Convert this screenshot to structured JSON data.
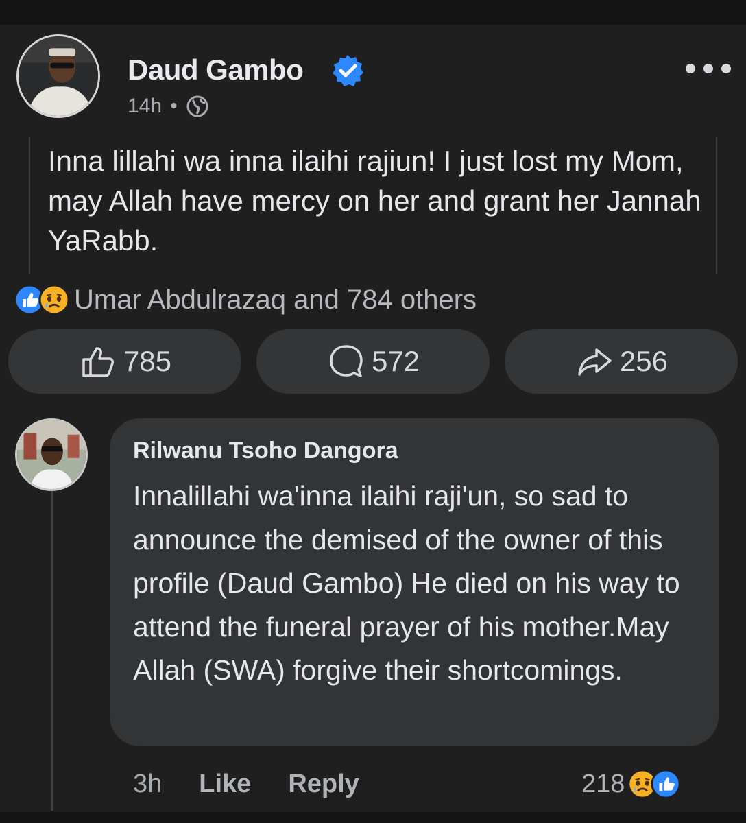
{
  "post": {
    "author": "Daud Gambo",
    "time": "14h",
    "separator": "•",
    "text": "Inna lillahi wa inna ilaihi rajiun! I just lost my Mom, may Allah have mercy on her and grant her Jannah YaRabb.",
    "reaction_summary": "Umar Abdulrazaq and 784 others",
    "reaction_icons": [
      "like-icon",
      "sad-icon"
    ],
    "actions": {
      "like_count": "785",
      "comment_count": "572",
      "share_count": "256"
    }
  },
  "comment": {
    "author": "Rilwanu Tsoho Dangora",
    "text": "Innalillahi wa'inna ilaihi raji'un, so sad to announce the demised of the owner of this profile (Daud Gambo) He died on his way to attend the funeral prayer of his mother.May Allah (SWA) forgive their shortcomings.",
    "time": "3h",
    "like_label": "Like",
    "reply_label": "Reply",
    "reaction_count": "218",
    "reaction_icons": [
      "sad-icon",
      "like-icon"
    ]
  },
  "colors": {
    "background": "#1f1f20",
    "accent": "#2d88ff",
    "sad_emoji": "#f7b125",
    "bubble": "#333436"
  }
}
